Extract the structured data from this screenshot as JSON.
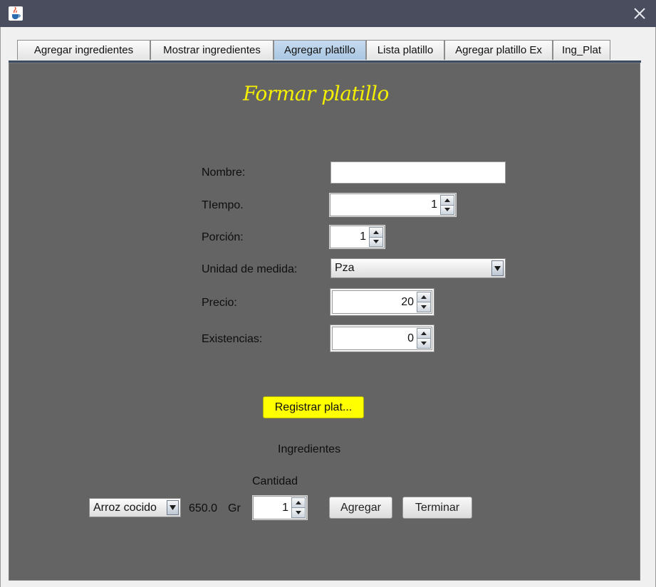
{
  "window": {
    "app_icon": "java-cup-icon",
    "close_icon": "close-icon"
  },
  "tabs": [
    {
      "label": "Agregar ingredientes",
      "selected": false
    },
    {
      "label": "Mostrar ingredientes",
      "selected": false
    },
    {
      "label": "Agregar platillo",
      "selected": true
    },
    {
      "label": "Lista platillo",
      "selected": false
    },
    {
      "label": "Agregar platillo Ex",
      "selected": false
    },
    {
      "label": "Ing_Plat",
      "selected": false
    }
  ],
  "form": {
    "heading": "Formar platillo",
    "nombre": {
      "label": "Nombre:",
      "value": ""
    },
    "tiempo": {
      "label": "TIempo.",
      "value": "1"
    },
    "porcion": {
      "label": "Porción:",
      "value": "1"
    },
    "unidad": {
      "label": "Unidad de medida:",
      "value": "Pza"
    },
    "precio": {
      "label": "Precio:",
      "value": "20"
    },
    "existencias": {
      "label": "Existencias:",
      "value": "0"
    },
    "register_button": "Registrar plat..."
  },
  "ingredients": {
    "title": "Ingredientes",
    "cantidad_label": "Cantidad",
    "combo_value": "Arroz cocido",
    "amount": "650.0",
    "unit": "Gr",
    "cantidad_value": "1",
    "add_button": "Agregar",
    "finish_button": "Terminar"
  },
  "colors": {
    "panel_bg": "#646464",
    "heading": "#f4f000",
    "titlebar": "#4a4d5e",
    "register_button": "#ffff00",
    "selected_tab": "#b8d1ea"
  }
}
